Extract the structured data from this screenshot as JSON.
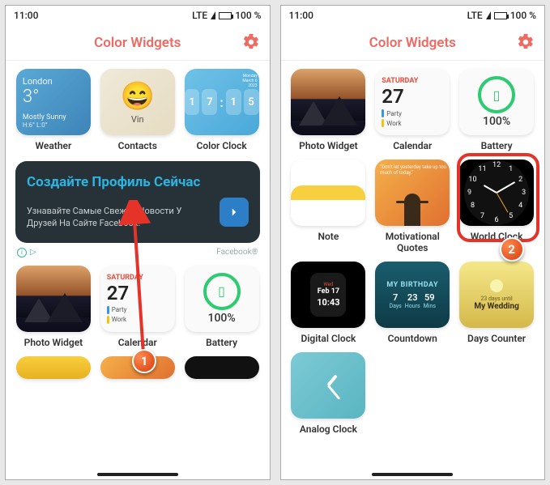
{
  "status": {
    "time": "11:00",
    "network": "LTE",
    "battery": "100 %"
  },
  "header": {
    "title": "Color Widgets"
  },
  "left": {
    "weather": {
      "city": "London",
      "temp": "3°",
      "cond": "Mostly Sunny",
      "range": "H:6° L:0°"
    },
    "contact": {
      "name": "Vin"
    },
    "captions": {
      "weather": "Weather",
      "contacts": "Contacts",
      "colorclock": "Color Clock"
    },
    "clock": {
      "h1": "1",
      "h2": "7",
      "m1": "1",
      "m2": "5",
      "side": "Monday\nMarch 6\n2023"
    },
    "ad": {
      "title": "Создайте Профиль Сейчас",
      "sub": "Узнавайте Самые Свежие Новости У Друзей На Сайте Facebook!",
      "brand": "Facebook®"
    },
    "calendar": {
      "dow": "SATURDAY",
      "day": "27",
      "ev1": "Party",
      "ev2": "Work"
    },
    "captions2": {
      "photo": "Photo Widget",
      "calendar": "Calendar",
      "battery": "Battery"
    },
    "battery": {
      "pct": "100%"
    }
  },
  "right": {
    "row1": {
      "calendar": {
        "dow": "SATURDAY",
        "day": "27",
        "ev1": "Party",
        "ev2": "Work"
      },
      "battery": {
        "pct": "100%"
      },
      "captions": {
        "photo": "Photo Widget",
        "calendar": "Calendar",
        "battery": "Battery"
      }
    },
    "row2": {
      "quote": "\"Don't let yesterday take up too much of today.\"",
      "captions": {
        "note": "Note",
        "quotes": "Motivational Quotes",
        "worldclock": "World Clock"
      },
      "clocknums": {
        "n12": "12",
        "n1": "1",
        "n2": "2",
        "n3": "3",
        "n4": "4",
        "n5": "5",
        "n6": "6",
        "n7": "7",
        "n8": "8",
        "n9": "9",
        "n10": "10",
        "n11": "11"
      }
    },
    "row3": {
      "digital": {
        "dow": "Wed",
        "date": "Feb 17",
        "time": "10:43"
      },
      "countdown": {
        "title": "MY BIRTHDAY",
        "d": "7",
        "h": "23",
        "m": "59",
        "dl": "Days",
        "hl": "Hours",
        "ml": "Mins"
      },
      "days": {
        "sub": "23 days until",
        "main": "My Wedding"
      },
      "captions": {
        "digital": "Digital Clock",
        "countdown": "Countdown",
        "days": "Days Counter"
      }
    },
    "row4": {
      "captions": {
        "analog": "Analog Clock"
      }
    }
  },
  "markers": {
    "m1": "1",
    "m2": "2"
  }
}
